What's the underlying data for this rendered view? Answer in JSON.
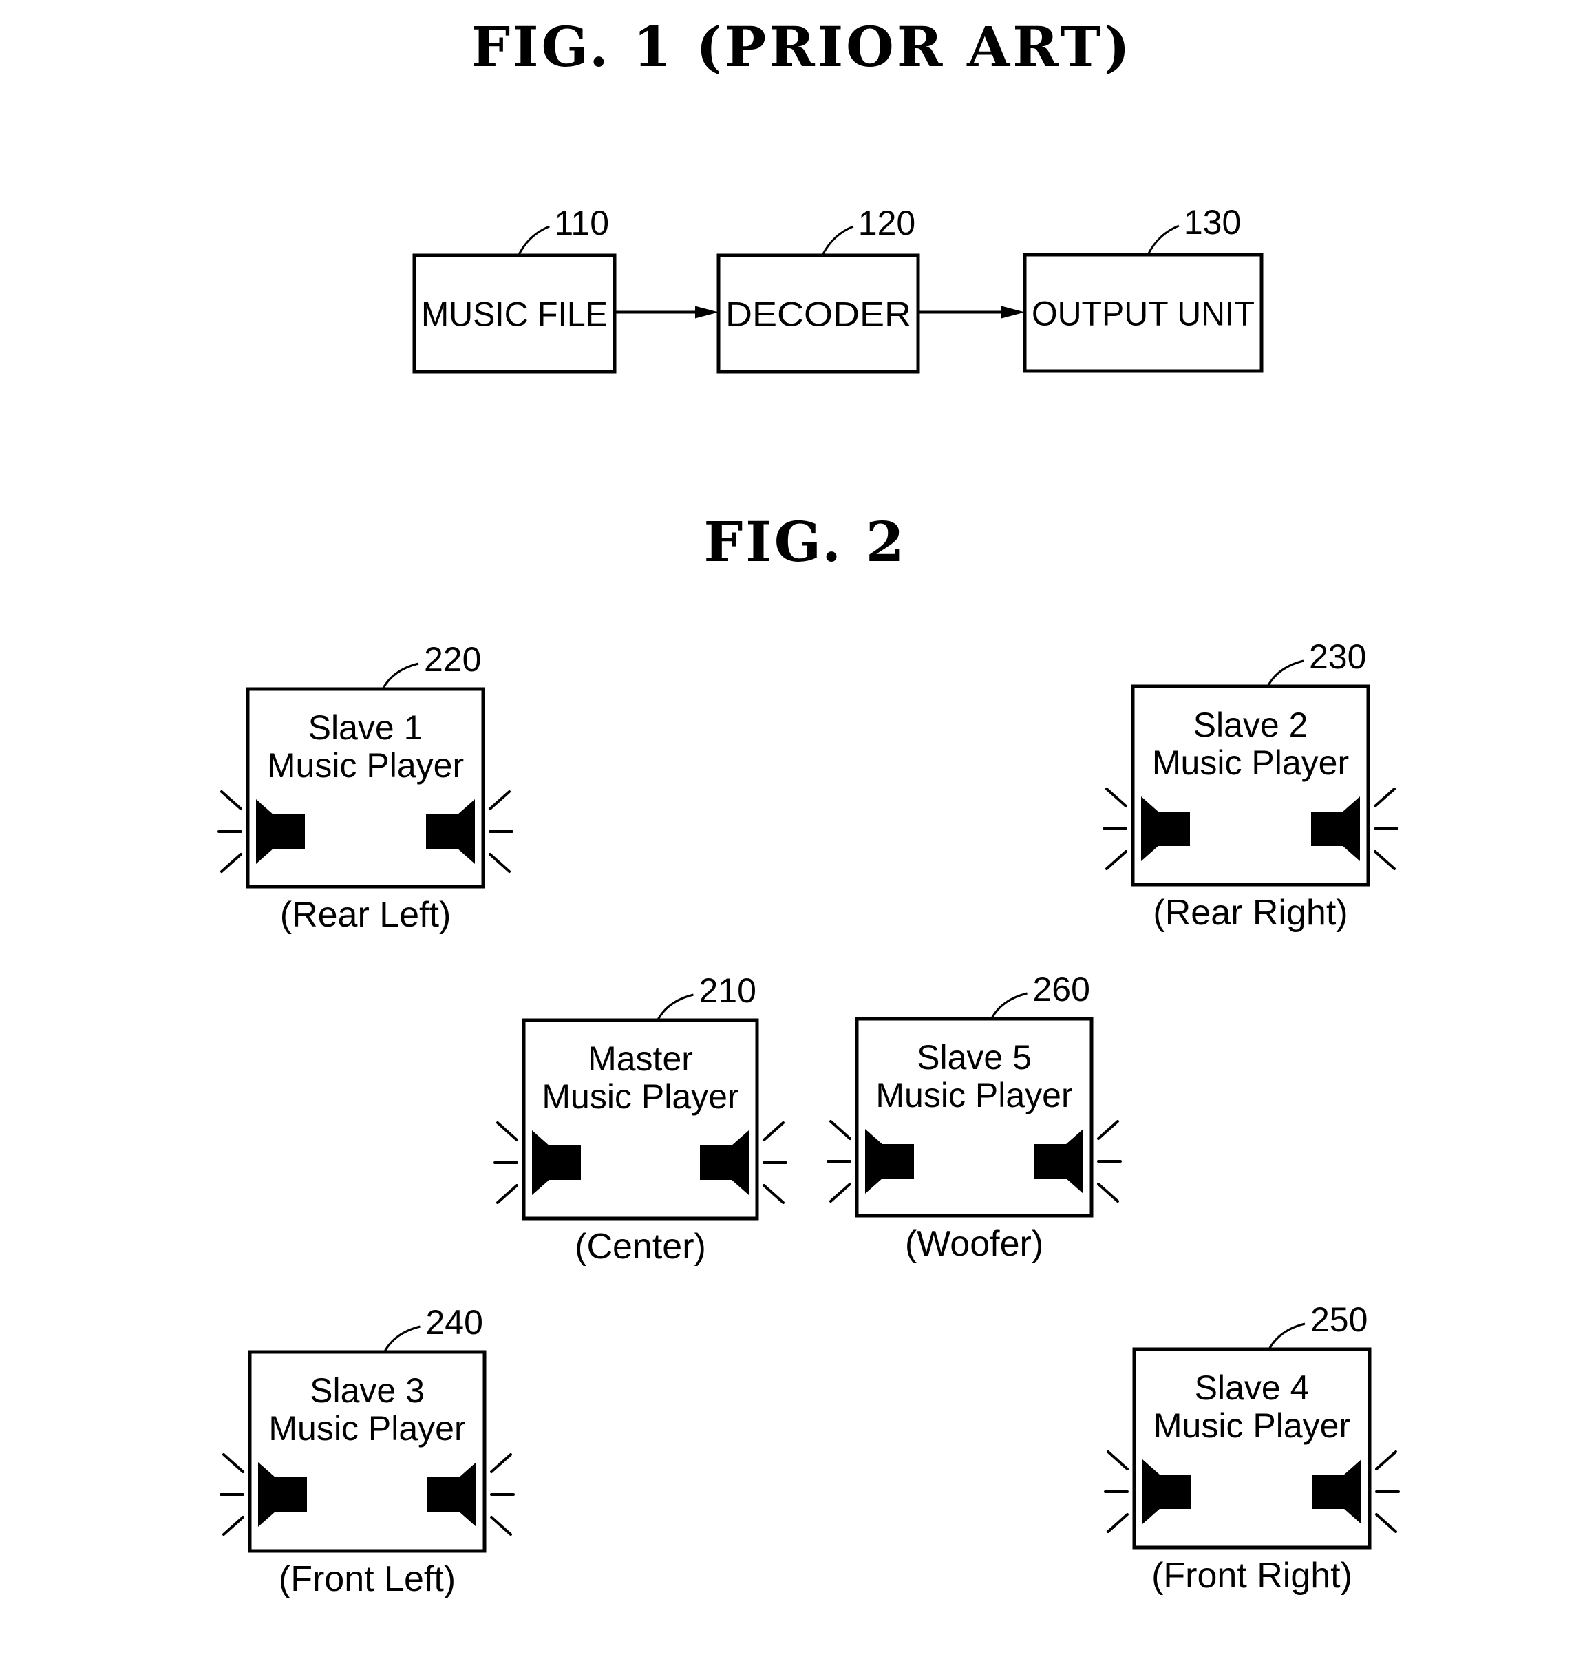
{
  "fig1": {
    "title": "FIG.  1  (PRIOR  ART)",
    "blocks": [
      {
        "id": "music-file",
        "ref": "110",
        "label": "MUSIC FILE"
      },
      {
        "id": "decoder",
        "ref": "120",
        "label": "DECODER"
      },
      {
        "id": "output-unit",
        "ref": "130",
        "label": "OUTPUT UNIT"
      }
    ],
    "flow": [
      [
        "music-file",
        "decoder"
      ],
      [
        "decoder",
        "output-unit"
      ]
    ]
  },
  "fig2": {
    "title": "FIG.  2",
    "players": [
      {
        "id": "slave-1",
        "ref": "220",
        "line1": "Slave 1",
        "line2": "Music Player",
        "caption": "(Rear Left)",
        "icon": "speaker-icon"
      },
      {
        "id": "slave-2",
        "ref": "230",
        "line1": "Slave 2",
        "line2": "Music Player",
        "caption": "(Rear Right)",
        "icon": "speaker-icon"
      },
      {
        "id": "master",
        "ref": "210",
        "line1": "Master",
        "line2": "Music Player",
        "caption": "(Center)",
        "icon": "speaker-icon"
      },
      {
        "id": "slave-5",
        "ref": "260",
        "line1": "Slave 5",
        "line2": "Music Player",
        "caption": "(Woofer)",
        "icon": "speaker-icon"
      },
      {
        "id": "slave-3",
        "ref": "240",
        "line1": "Slave 3",
        "line2": "Music Player",
        "caption": "(Front Left)",
        "icon": "speaker-icon"
      },
      {
        "id": "slave-4",
        "ref": "250",
        "line1": "Slave 4",
        "line2": "Music Player",
        "caption": "(Front Right)",
        "icon": "speaker-icon"
      }
    ]
  }
}
